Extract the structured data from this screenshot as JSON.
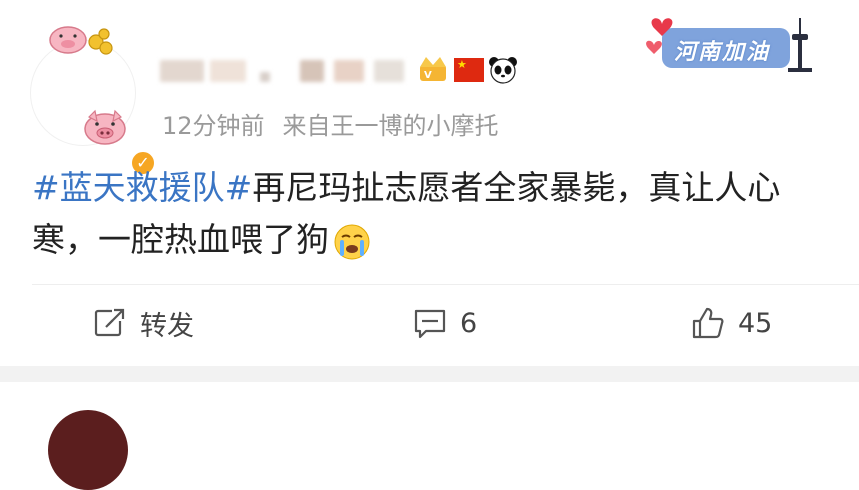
{
  "post": {
    "meta": {
      "time": "12分钟前",
      "source": "来自王一博的小摩托"
    },
    "banner": {
      "text": "河南加油"
    },
    "content": {
      "topic": "#蓝天救援队#",
      "body": "再尼玛扯志愿者全家暴毙，真让人心寒，一腔热血喂了狗"
    },
    "actions": {
      "repost_label": "转发",
      "comment_count": "6",
      "like_count": "45"
    },
    "colors": {
      "topic": "#3a75c4",
      "verified": "#f6a623",
      "meta": "#9a9a9a"
    },
    "icons": {
      "verified": "verified-badge-icon",
      "repost": "repost-icon",
      "comment": "comment-icon",
      "like": "thumbs-up-icon"
    }
  }
}
